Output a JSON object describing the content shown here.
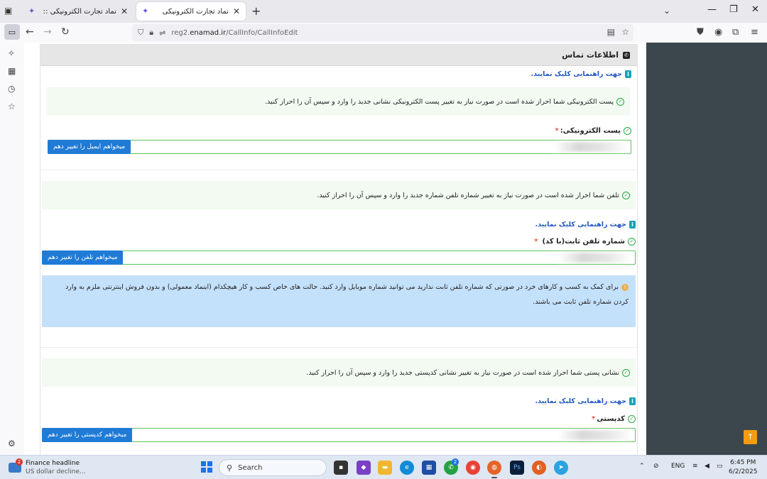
{
  "browser": {
    "tabs": [
      {
        "title": "نماد تجارت الکترونیکی :: انتخا...",
        "active": false
      },
      {
        "title": "نماد تجارت الکترونیکی",
        "active": true
      }
    ],
    "url_prefix": "reg2.",
    "url_domain": "enamad.ir",
    "url_path": "/CallInfo/CallInfoEdit"
  },
  "page": {
    "header_title": "اطلاعات تماس",
    "guide_link": "جهت راهنمایی کلیک نمایید.",
    "email_notice": "پست الکترونیکی شما احراز شده است در صورت نیاز به تغییر پست الکترونیکی نشانی جدید را وارد و سپس آن را احراز کنید.",
    "email_label": "پست الکترونیکی:",
    "email_required": "*",
    "email_button": "میخواهم ایمیل را تغییر دهم",
    "phone_notice": "تلفن شما احراز شده است در صورت نیاز به تغییر شماره تلفن شماره جدید را وارد و سپس آن را احراز کنید.",
    "phone_label": "شماره تلفن ثابت(با کد)",
    "phone_required": "*",
    "phone_button": "میخواهم تلفن را تغییر دهم",
    "info_text": "برای کمک به کسب و کارهای خرد در صورتی که شماره تلفن ثابت ندارید می توانید شماره موبایل وارد کنید. حالت های خاص کسب و کار هیچکدام (اینماد معمولی) و بدون فروش اینترنتی ملزم به وارد کردن شماره تلفن ثابت می باشند.",
    "postal_notice": "نشانی پستی شما احراز شده است در صورت نیاز به تغییر نشانی کدپستی جدید را وارد و سپس آن را احراز کنید.",
    "postal_label": "کدپستی",
    "postal_required": "*",
    "postal_button": "میخواهم کدپستی را تغییر دهم"
  },
  "taskbar": {
    "weather_title": "Finance headline",
    "weather_sub": "US dollar decline...",
    "weather_badge": "2",
    "search_placeholder": "Search",
    "whatsapp_badge": "2",
    "lang": "ENG",
    "time": "6:45 PM",
    "date": "6/2/2025"
  },
  "colors": {
    "accent_blue": "#1f7bd6",
    "success_green": "#28a745",
    "info_bg": "#c4e1fb",
    "right_panel": "#3c474d"
  }
}
